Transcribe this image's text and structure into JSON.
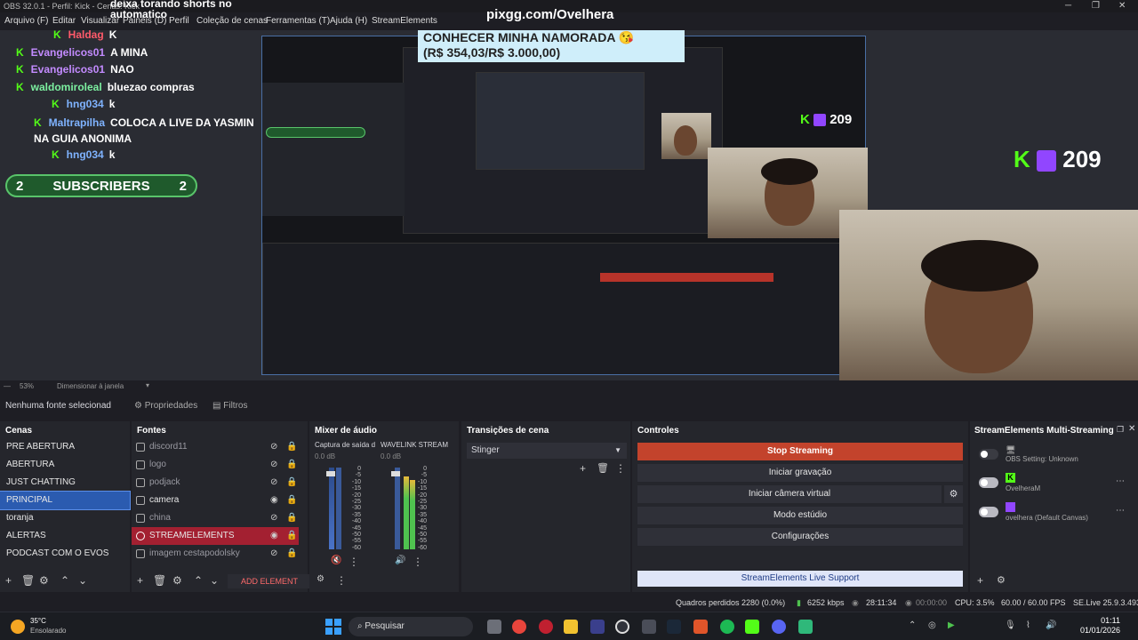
{
  "window": {
    "title": "OBS 32.0.1 - Perfil: Kick - Cenas: Kick"
  },
  "menu": [
    "Arquivo (F)",
    "Editar",
    "Visualizar",
    "Painéis (D)",
    "Perfil",
    "Coleção de cenas",
    "Ferramentas (T)",
    "Ajuda (H)",
    "StreamElements"
  ],
  "preview": {
    "url": "pixgg.com/Ovelhera",
    "top_overlay_text": "deixa torando shorts no automatico",
    "chat": [
      {
        "user": "Haldag",
        "msg": "K"
      },
      {
        "user": "Evangelicos01",
        "msg": "A MINA"
      },
      {
        "user": "Evangelicos01",
        "msg": "NAO"
      },
      {
        "user": "waldomiroleal",
        "msg": "bluezao compras"
      },
      {
        "user": "hng034",
        "msg": "k"
      },
      {
        "user": "Maltrapilha",
        "msg": "COLOCA A LIVE DA YASMIN NA GUIA ANONIMA"
      },
      {
        "user": "hng034",
        "msg": "k"
      }
    ],
    "subs_left": "2",
    "subs_label": "SUBSCRIBERS",
    "subs_right": "2",
    "goal_title": "CONHECER MINHA NAMORADA 😘",
    "goal_value": "(R$ 354,03/R$ 3.000,00)",
    "viewer_count": "209"
  },
  "zoom": {
    "percent": "53%",
    "mode": "Dimensionar à janela"
  },
  "source_bar": {
    "none_selected": "Nenhuma fonte selecionad",
    "properties": "Propriedades",
    "filters": "Filtros"
  },
  "scenes": {
    "title": "Cenas",
    "items": [
      "PRE ABERTURA",
      "ABERTURA",
      "JUST CHATTING",
      "PRINCIPAL",
      "toranja",
      "ALERTAS",
      "PODCAST COM O EVOS"
    ],
    "selected": "PRINCIPAL"
  },
  "sources": {
    "title": "Fontes",
    "items": [
      "discord11",
      "logo",
      "podjack",
      "camera",
      "china",
      "STREAMELEMENTS",
      "imagem cestapodolsky"
    ],
    "add_element": "ADD ELEMENT"
  },
  "mixer": {
    "title": "Mixer de áudio",
    "channels": [
      {
        "name": "Captura de saída d",
        "db": "0.0 dB"
      },
      {
        "name": "WAVELINK STREAM",
        "db": "0.0 dB"
      }
    ],
    "scale": [
      "0",
      "-5",
      "-10",
      "-15",
      "-20",
      "-25",
      "-30",
      "-35",
      "-40",
      "-45",
      "-50",
      "-55",
      "-60"
    ]
  },
  "transitions": {
    "title": "Transições de cena",
    "selected": "Stinger"
  },
  "controls": {
    "title": "Controles",
    "stop_streaming": "Stop Streaming",
    "start_recording": "Iniciar gravação",
    "start_virtual_cam": "Iniciar câmera virtual",
    "studio_mode": "Modo estúdio",
    "settings": "Configurações",
    "live_support": "StreamElements Live Support"
  },
  "multistream": {
    "title": "StreamElements Multi-Streaming",
    "rows": [
      {
        "label": "OBS Setting: Unknown"
      },
      {
        "label": "OvelheraM"
      },
      {
        "label": "ovelhera (Default Canvas)"
      }
    ]
  },
  "status": {
    "dropped_frames": "Quadros perdidos 2280 (0.0%)",
    "bitrate": "6252 kbps",
    "stream_time": "28:11:34",
    "rec_time": "00:00:00",
    "cpu": "CPU: 3.5%",
    "fps": "60.00 / 60.00 FPS",
    "version": "SE.Live 25.9.3.493"
  },
  "taskbar": {
    "weather_temp": "35°C",
    "weather_desc": "Ensolarado",
    "search": "Pesquisar",
    "time": "01:11",
    "date": "01/01/2026"
  },
  "colors": {
    "accent": "#2b5bb0",
    "stop": "#c3432c",
    "kick": "#53fc18",
    "twitch": "#9146ff"
  }
}
